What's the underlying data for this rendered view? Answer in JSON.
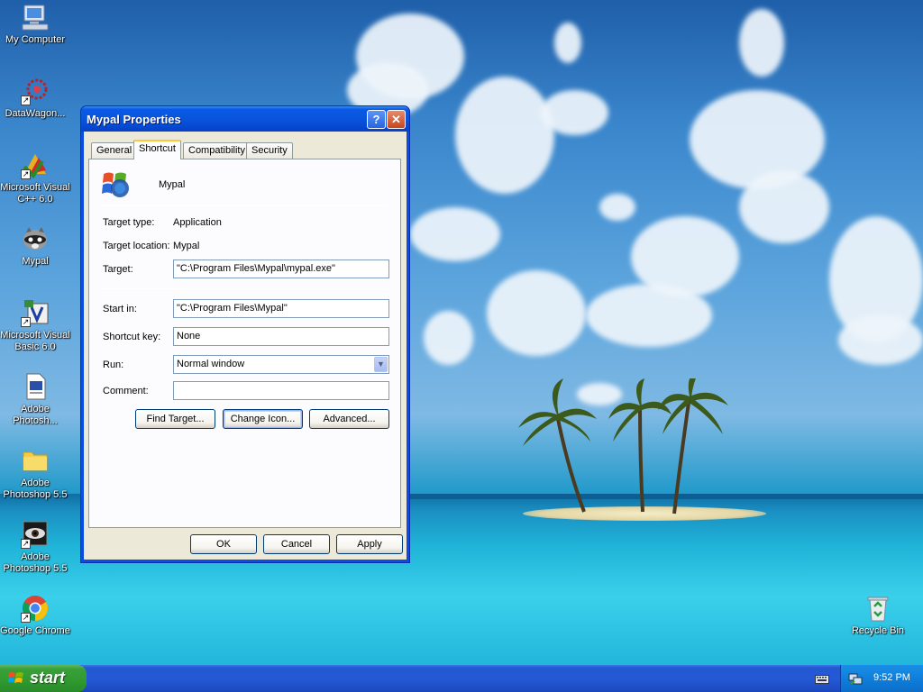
{
  "desktop": {
    "icons": [
      {
        "label": "My Computer",
        "icon": "my-computer-icon"
      },
      {
        "label": "DataWagon...",
        "icon": "datawagon-icon"
      },
      {
        "label": "Microsoft Visual C++ 6.0",
        "icon": "visual-cpp-icon"
      },
      {
        "label": "Mypal",
        "icon": "mypal-raccoon-icon"
      },
      {
        "label": "Microsoft Visual Basic 6.0",
        "icon": "visual-basic-icon"
      },
      {
        "label": "Adobe Photosh...",
        "icon": "document-icon"
      },
      {
        "label": "Adobe Photoshop 5.5",
        "icon": "folder-icon"
      },
      {
        "label": "Adobe Photoshop 5.5",
        "icon": "photoshop-eye-icon"
      },
      {
        "label": "Google Chrome",
        "icon": "chrome-icon"
      },
      {
        "label": "Recycle Bin",
        "icon": "recycle-bin-icon"
      }
    ]
  },
  "dialog": {
    "title": "Mypal Properties",
    "help_glyph": "?",
    "close_glyph": "✕",
    "tabs": [
      "General",
      "Shortcut",
      "Compatibility",
      "Security"
    ],
    "active_tab": "Shortcut",
    "app_name": "Mypal",
    "target_type_label": "Target type:",
    "target_type_value": "Application",
    "target_location_label": "Target location:",
    "target_location_value": "Mypal",
    "target_label": "Target:",
    "target_value": "\"C:\\Program Files\\Mypal\\mypal.exe\"",
    "start_in_label": "Start in:",
    "start_in_value": "\"C:\\Program Files\\Mypal\"",
    "shortcut_key_label": "Shortcut key:",
    "shortcut_key_value": "None",
    "run_label": "Run:",
    "run_value": "Normal window",
    "comment_label": "Comment:",
    "comment_value": "",
    "find_target_label": "Find Target...",
    "change_icon_label": "Change Icon...",
    "advanced_label": "Advanced...",
    "ok_label": "OK",
    "cancel_label": "Cancel",
    "apply_label": "Apply"
  },
  "taskbar": {
    "start_label": "start",
    "clock": "9:52 PM"
  }
}
